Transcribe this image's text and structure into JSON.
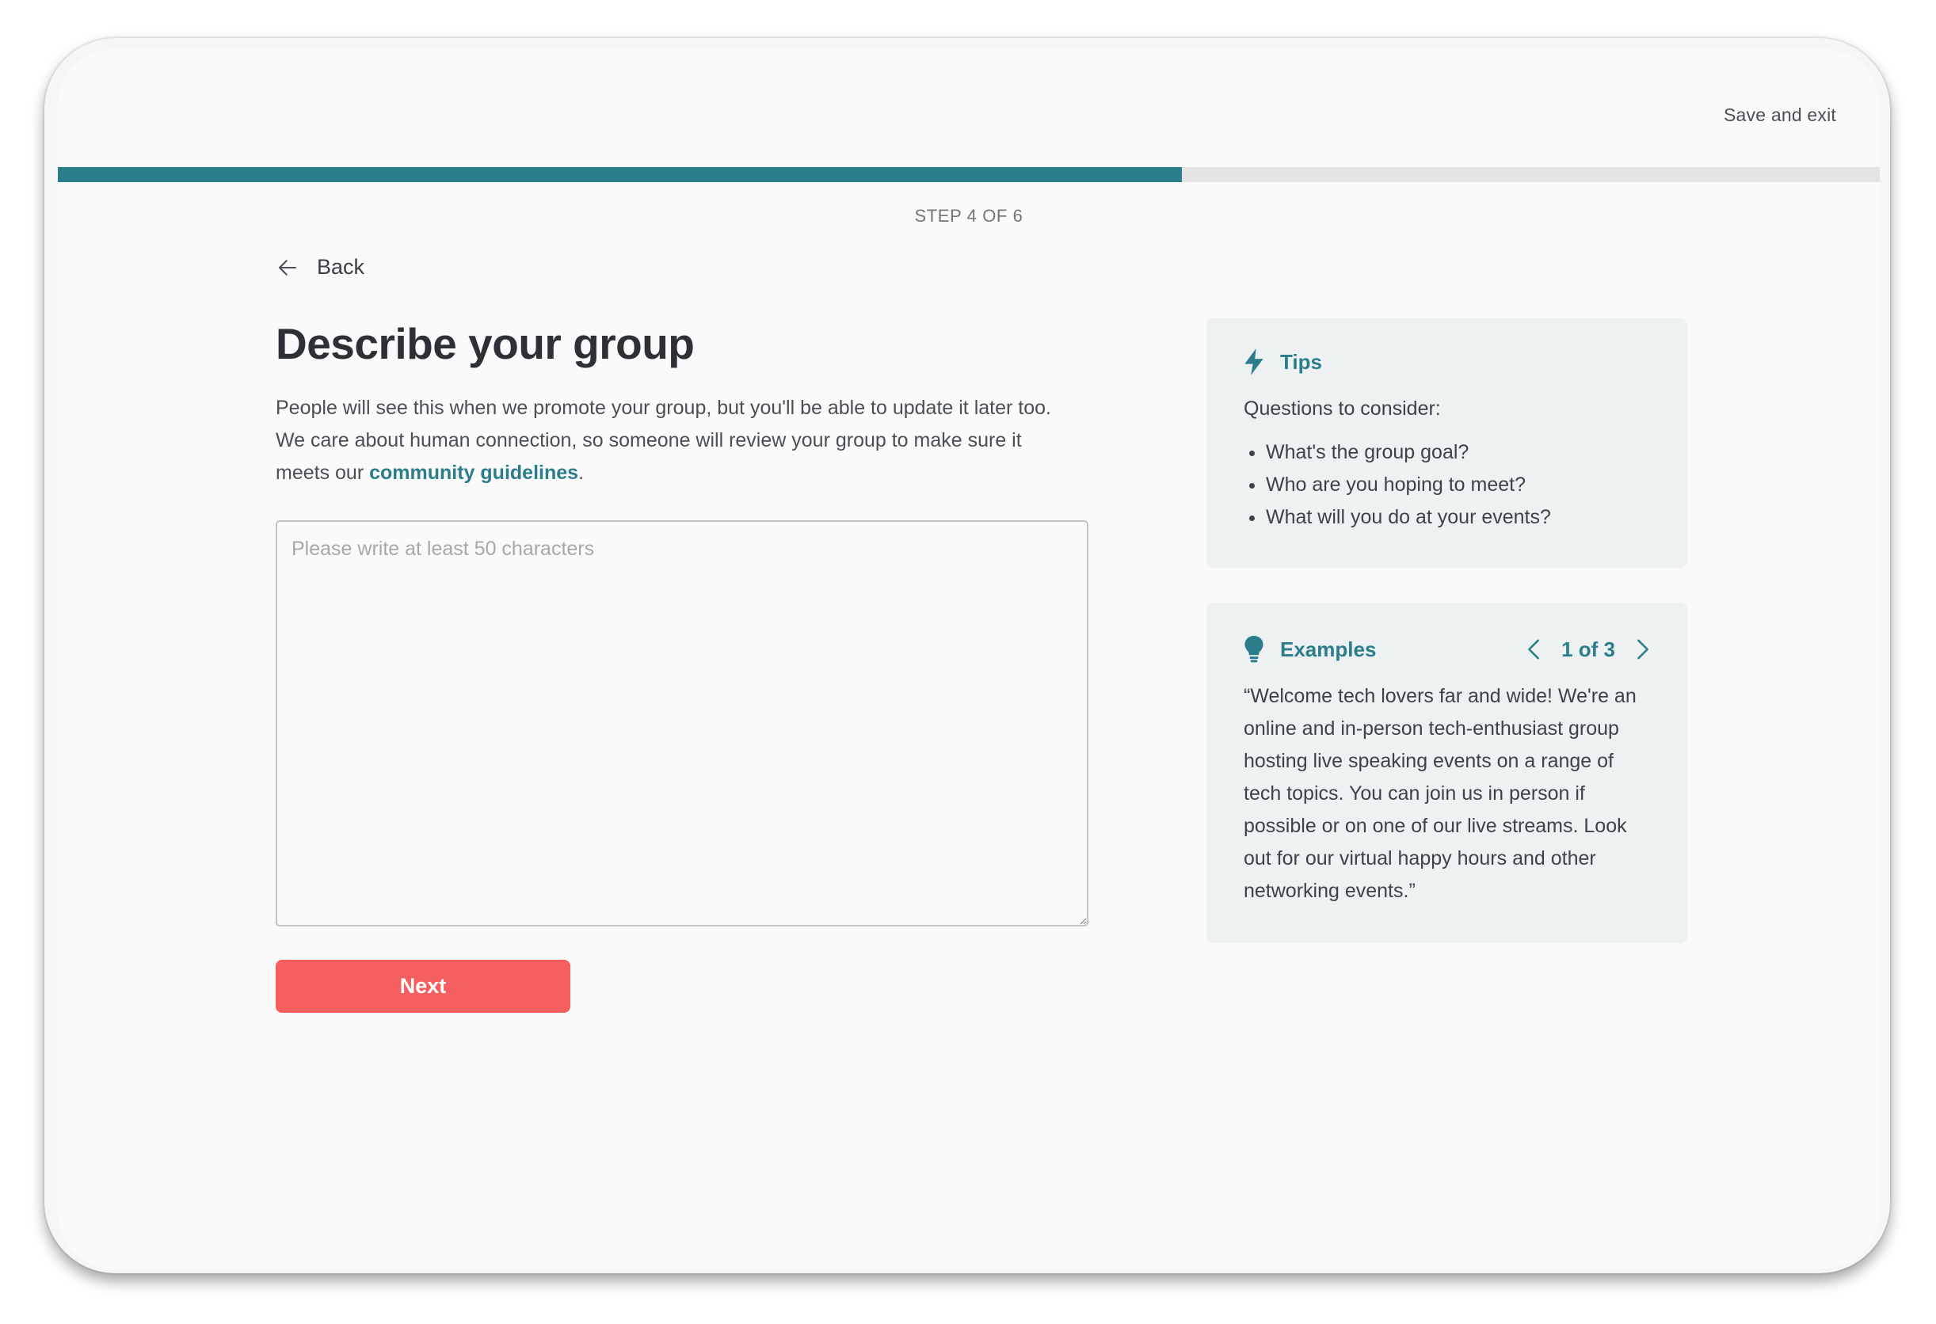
{
  "header": {
    "save_exit": "Save and exit"
  },
  "progress": {
    "current_step": 4,
    "total_steps": 6,
    "fraction": 0.617,
    "step_label": "STEP 4 OF 6",
    "color": "#2c7d8b"
  },
  "nav": {
    "back_label": "Back",
    "back_icon": "arrow-left-icon"
  },
  "main": {
    "title": "Describe your group",
    "description_before_link": "People will see this when we promote your group, but you'll be able to update it later too.  We care about human connection, so someone will review your group to make sure it meets our ",
    "link_text": "community guidelines",
    "description_after_link": ".",
    "textarea": {
      "value": "",
      "placeholder": "Please write at least 50 characters"
    },
    "next_label": "Next",
    "next_color": "#f65f5f"
  },
  "tips": {
    "icon": "lightning-icon",
    "title": "Tips",
    "subtitle": "Questions to consider:",
    "items": [
      "What's the group goal?",
      "Who are you hoping to meet?",
      "What will you do at your events?"
    ]
  },
  "examples": {
    "icon": "lightbulb-icon",
    "title": "Examples",
    "counter": "1 of 3",
    "text": "“Welcome tech lovers far and wide! We're an online and in-person tech-enthusiast group hosting live speaking events on a range of tech topics. You can join us in person if possible or on one of our live streams. Look out for our virtual happy hours and other networking events.”"
  }
}
